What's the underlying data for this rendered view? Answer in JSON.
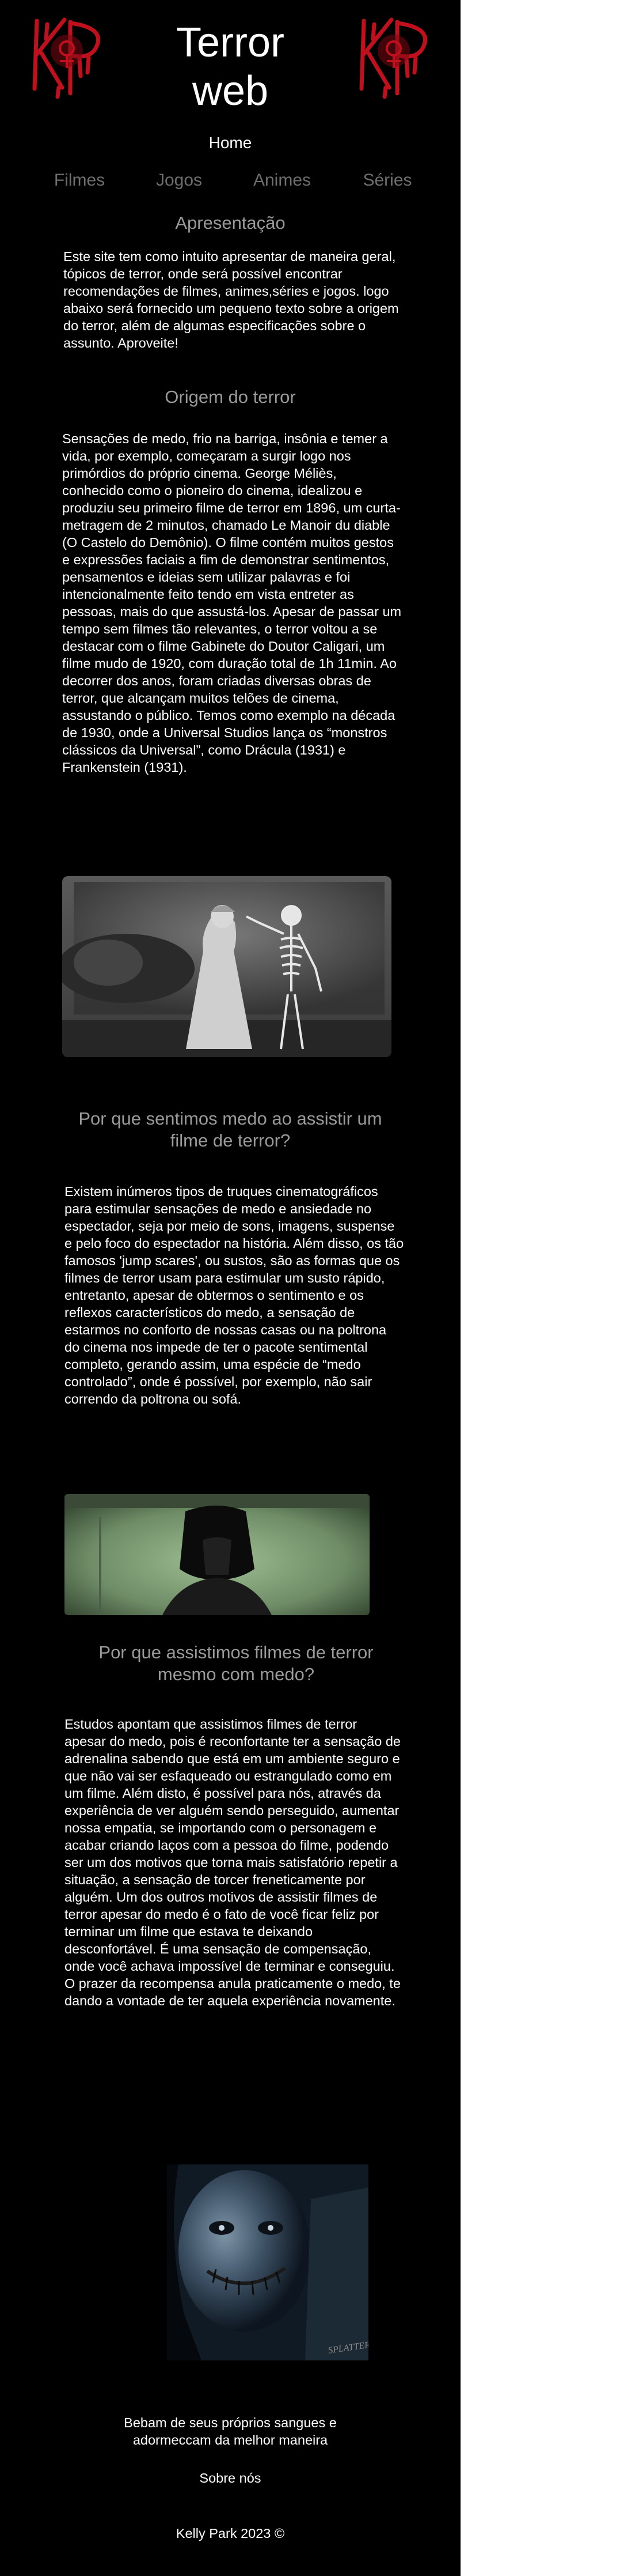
{
  "header": {
    "title": "Terror web",
    "home_label": "Home"
  },
  "nav": {
    "items": [
      {
        "label": "Filmes"
      },
      {
        "label": "Jogos"
      },
      {
        "label": "Animes"
      },
      {
        "label": "Séries"
      }
    ]
  },
  "sections": {
    "intro": {
      "title": "Apresentação",
      "text": "Este site tem como intuito apresentar de maneira geral, tópicos de terror, onde será possível encontrar recomendações de filmes, animes,séries e jogos. logo abaixo será fornecido um pequeno texto sobre a origem do terror, além de algumas especificações sobre o assunto. Aproveite!"
    },
    "origin": {
      "title": "Origem do terror",
      "text": "Sensações de medo, frio na barriga, insônia e temer a vida, por exemplo, começaram a surgir logo nos primórdios do próprio cinema. George Méliès, conhecido como o pioneiro do cinema, idealizou e produziu seu primeiro filme de terror em 1896, um curta-metragem de 2 minutos, chamado Le Manoir du diable (O Castelo do Demônio). O filme contém muitos gestos e expressões faciais a fim de demonstrar sentimentos, pensamentos e ideias sem utilizar palavras e foi intencionalmente feito tendo em vista entreter as pessoas, mais do que assustá-los. Apesar de passar um tempo sem filmes tão relevantes, o terror voltou a se destacar com o filme Gabinete do Doutor Caligari, um filme mudo de 1920, com duração total de 1h 11min. Ao decorrer dos anos, foram criadas diversas obras de terror, que alcançam muitos telões de cinema, assustando o público. Temos como exemplo na década de 1930, onde a Universal Studios lança os “monstros clássicos da Universal”, como Drácula (1931) e Frankenstein (1931)."
    },
    "why_fear": {
      "title": "Por que sentimos medo ao assistir um filme de terror?",
      "text": "Existem inúmeros tipos de truques cinematográficos para estimular sensações de medo e ansiedade no espectador, seja por meio de sons, imagens, suspense e pelo foco do espectador na história. Além disso, os tão famosos 'jump scares', ou sustos, são as formas que os filmes de terror usam para estimular um susto rápido, entretanto, apesar de obtermos o sentimento e os reflexos característicos do medo, a sensação de estarmos no conforto de nossas casas ou na poltrona do cinema nos impede de ter o pacote sentimental completo, gerando assim, uma espécie de “medo controlado”, onde é possível, por exemplo, não sair correndo da poltrona ou sofá."
    },
    "why_watch": {
      "title": "Por que assistimos filmes de terror mesmo com medo?",
      "text": "Estudos apontam que assistimos filmes de terror apesar do medo, pois é reconfortante ter a sensação de adrenalina sabendo que está em um ambiente seguro e que não vai ser esfaqueado ou estrangulado como em um filme. Além disto, é possível para nós, através da experiência de ver alguém sendo perseguido, aumentar nossa empatia, se importando com o personagem e acabar criando laços com a pessoa do filme, podendo ser um dos motivos que torna mais satisfatório repetir a situação, a sensação de torcer freneticamente por alguém. Um dos outros motivos de assistir filmes de terror apesar do medo é o fato de você ficar feliz por terminar um filme que estava te deixando desconfortável. É uma sensação de compensação, onde você achava impossível de terminar e conseguiu. O prazer da recompensa anula praticamente o medo, te dando a vontade de ter aquela experiência novamente."
    }
  },
  "images": {
    "watermark": "SPLATTER"
  },
  "footer": {
    "tagline": "Bebam de seus próprios sangues e adormeccam da melhor maneira",
    "about_label": "Sobre nós",
    "copyright": "Kelly Park 2023 ©"
  },
  "colors": {
    "page_background": "#000000",
    "outer_background": "#ffffff",
    "logo_red": "#c0101e",
    "nav_gray": "#6e6e6e",
    "section_title_gray": "#9a9a9a"
  }
}
